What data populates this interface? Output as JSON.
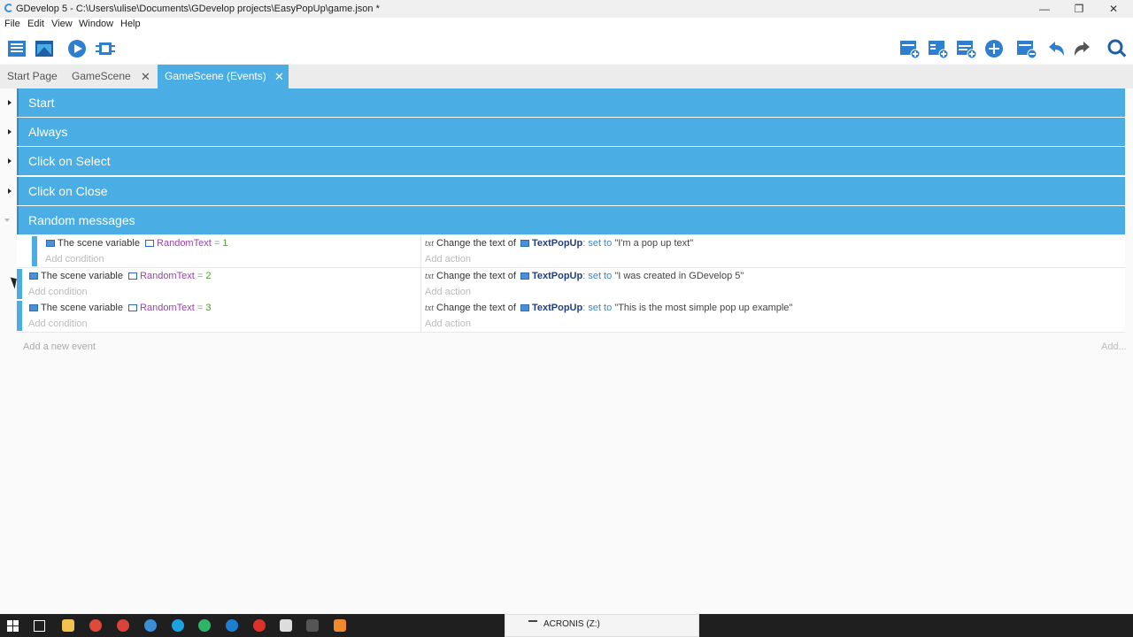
{
  "window": {
    "title": "GDevelop 5 - C:\\Users\\ulise\\Documents\\GDevelop projects\\EasyPopUp\\game.json *",
    "minimize_glyph": "—",
    "restore_glyph": "❐",
    "close_glyph": "✕"
  },
  "menu": [
    "File",
    "Edit",
    "View",
    "Window",
    "Help"
  ],
  "toolbar": {
    "left_icons": [
      "project-manager-icon",
      "scene-editor-icon",
      "preview-play-icon",
      "debugger-icon"
    ],
    "right_icons": [
      "add-event-icon",
      "add-subevent-icon",
      "add-comment-icon",
      "add-more-icon",
      "delete-event-icon",
      "undo-icon",
      "redo-icon",
      "search-icon"
    ]
  },
  "tabs": [
    {
      "label": "Start Page",
      "closable": false
    },
    {
      "label": "GameScene",
      "closable": true
    },
    {
      "label": "GameScene (Events)",
      "closable": true,
      "active": true
    }
  ],
  "close_glyph": "✕",
  "groups": [
    {
      "label": "Start",
      "collapsed": true
    },
    {
      "label": "Always",
      "collapsed": true
    },
    {
      "label": "Click on Select",
      "collapsed": true
    },
    {
      "label": "Click on Close",
      "collapsed": true
    },
    {
      "label": "Random messages",
      "collapsed": false
    }
  ],
  "events": [
    {
      "cond_prefix": "The scene variable",
      "variable": "RandomText",
      "operator": "=",
      "value": "1",
      "add_condition": "Add condition",
      "action_prefix": "Change the text of",
      "object": "TextPopUp",
      "action_mid": ": set to",
      "string": "\"I'm a pop up text\"",
      "add_action": "Add action"
    },
    {
      "cond_prefix": "The scene variable",
      "variable": "RandomText",
      "operator": "=",
      "value": "2",
      "add_condition": "Add condition",
      "action_prefix": "Change the text of",
      "object": "TextPopUp",
      "action_mid": ": set to",
      "string": "\"I was created in GDevelop 5\"",
      "add_action": "Add action"
    },
    {
      "cond_prefix": "The scene variable",
      "variable": "RandomText",
      "operator": "=",
      "value": "3",
      "add_condition": "Add condition",
      "action_prefix": "Change the text of",
      "object": "TextPopUp",
      "action_mid": ": set to",
      "string": "\"This is the most simple pop up example\"",
      "add_action": "Add action"
    }
  ],
  "action_type_icon": "txt",
  "add_event": "Add a new event",
  "add_more": "Add...",
  "taskbar": {
    "drive_label": "ACRONIS (Z:)"
  },
  "colors": {
    "accent": "#4aade3",
    "variable": "#9b3fb4",
    "number": "#4a9f2c",
    "object": "#23407c"
  }
}
